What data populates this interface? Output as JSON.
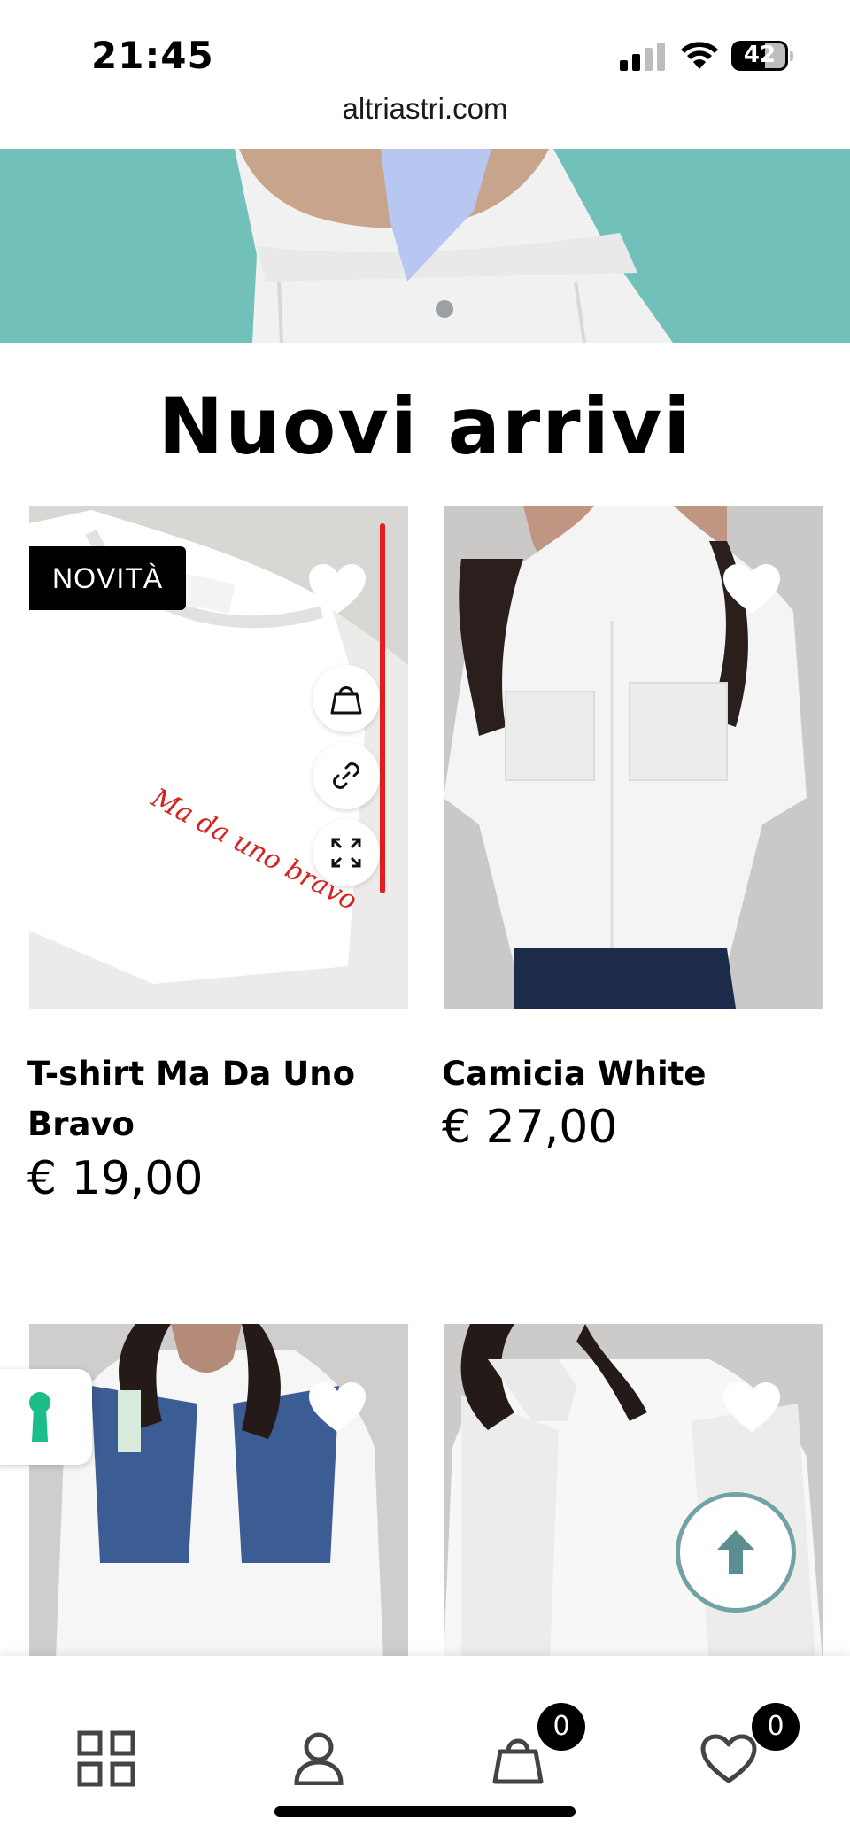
{
  "status_bar": {
    "time": "21:45",
    "battery": "42"
  },
  "browser": {
    "url": "altriastri.com"
  },
  "section": {
    "title": "Nuovi arrivi"
  },
  "products": [
    {
      "name": "T-shirt Ma Da Uno Bravo",
      "price": "€ 19,00",
      "badge": "NOVITÀ",
      "embroidery": "Ma da uno bravo"
    },
    {
      "name": "Camicia White",
      "price": "€ 27,00"
    },
    {
      "name": "",
      "price": ""
    },
    {
      "name": "",
      "price": ""
    }
  ],
  "bottom_nav": {
    "items": [
      {
        "icon": "grid-icon"
      },
      {
        "icon": "user-icon"
      },
      {
        "icon": "bag-icon",
        "count": "0"
      },
      {
        "icon": "heart-icon",
        "count": "0"
      }
    ]
  },
  "colors": {
    "hero_bg": "#72c0ba",
    "accent_green": "#1dbd8a",
    "to_top_border": "#6fa3a5",
    "red_marker": "#e21e1e"
  }
}
